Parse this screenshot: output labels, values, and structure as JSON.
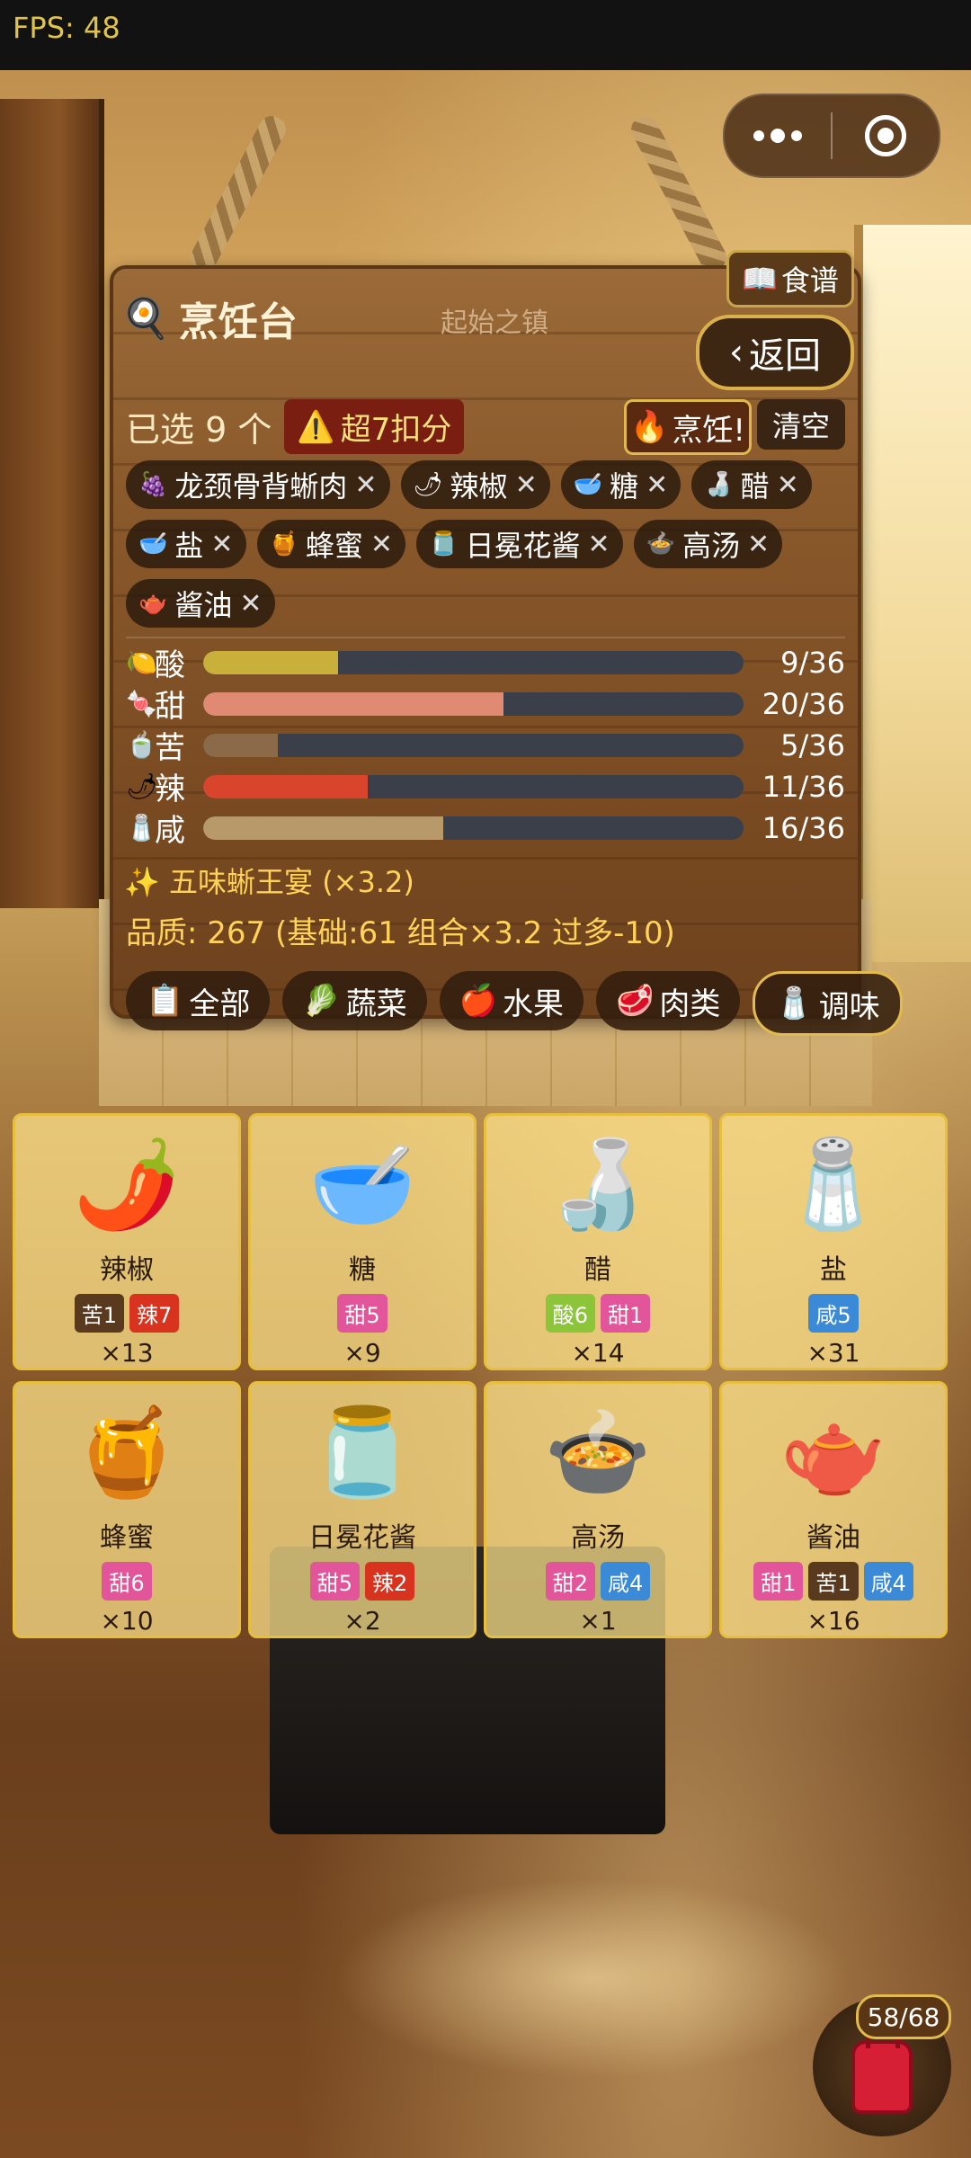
{
  "status": {
    "fps_text": "FPS: 48"
  },
  "header": {
    "title": "烹饪台",
    "location": "起始之镇",
    "recipe_label": "食谱",
    "back_label": "返回"
  },
  "selection": {
    "selected_text": "已选 9 个",
    "over_text": "超7扣分",
    "cook_label": "烹饪!",
    "clear_label": "清空",
    "chips": [
      {
        "icon": "🍇",
        "label": "龙颈骨背蜥肉"
      },
      {
        "icon": "🌶",
        "label": "辣椒"
      },
      {
        "icon": "🥣",
        "label": "糖"
      },
      {
        "icon": "🍶",
        "label": "醋"
      },
      {
        "icon": "🥣",
        "label": "盐"
      },
      {
        "icon": "🍯",
        "label": "蜂蜜"
      },
      {
        "icon": "🫙",
        "label": "日冕花酱"
      },
      {
        "icon": "🍲",
        "label": "高汤"
      },
      {
        "icon": "🫖",
        "label": "酱油"
      }
    ],
    "remove_glyph": "✕"
  },
  "tastes": [
    {
      "icon": "🍋",
      "name": "酸",
      "value": 9,
      "max": 36,
      "text": "9/36",
      "color": "#c9b03a"
    },
    {
      "icon": "🍬",
      "name": "甜",
      "value": 20,
      "max": 36,
      "text": "20/36",
      "color": "#e08a74"
    },
    {
      "icon": "🍵",
      "name": "苦",
      "value": 5,
      "max": 36,
      "text": "5/36",
      "color": "#8a6a48"
    },
    {
      "icon": "🌶",
      "name": "辣",
      "value": 11,
      "max": 36,
      "text": "11/36",
      "color": "#d8442c"
    },
    {
      "icon": "🧂",
      "name": "咸",
      "value": 16,
      "max": 36,
      "text": "16/36",
      "color": "#b89a6a"
    }
  ],
  "combo_text": "✨ 五味蜥王宴 (×3.2)",
  "quality_text": "品质: 267 (基础:61 组合×3.2 过多-10)",
  "tabs": [
    {
      "icon": "📋",
      "label": "全部",
      "active": false
    },
    {
      "icon": "🥬",
      "label": "蔬菜",
      "active": false
    },
    {
      "icon": "🍎",
      "label": "水果",
      "active": false
    },
    {
      "icon": "🥩",
      "label": "肉类",
      "active": false
    },
    {
      "icon": "🧂",
      "label": "调味",
      "active": true
    }
  ],
  "ingredients": [
    {
      "icon": "🌶️",
      "name": "辣椒",
      "count": "×13",
      "tags": [
        {
          "text": "苦1",
          "color": "#5a3a1e"
        },
        {
          "text": "辣7",
          "color": "#d8331f"
        }
      ]
    },
    {
      "icon": "🥣",
      "name": "糖",
      "count": "×9",
      "tags": [
        {
          "text": "甜5",
          "color": "#e2559a"
        }
      ]
    },
    {
      "icon": "🍶",
      "name": "醋",
      "count": "×14",
      "tags": [
        {
          "text": "酸6",
          "color": "#8cc43a"
        },
        {
          "text": "甜1",
          "color": "#e2559a"
        }
      ]
    },
    {
      "icon": "🧂",
      "name": "盐",
      "count": "×31",
      "tags": [
        {
          "text": "咸5",
          "color": "#3a8ad8"
        }
      ]
    },
    {
      "icon": "🍯",
      "name": "蜂蜜",
      "count": "×10",
      "tags": [
        {
          "text": "甜6",
          "color": "#e2559a"
        }
      ]
    },
    {
      "icon": "🫙",
      "name": "日冕花酱",
      "count": "×2",
      "tags": [
        {
          "text": "甜5",
          "color": "#e2559a"
        },
        {
          "text": "辣2",
          "color": "#d8331f"
        }
      ]
    },
    {
      "icon": "🍲",
      "name": "高汤",
      "count": "×1",
      "tags": [
        {
          "text": "甜2",
          "color": "#e2559a"
        },
        {
          "text": "咸4",
          "color": "#3a8ad8"
        }
      ]
    },
    {
      "icon": "🫖",
      "name": "酱油",
      "count": "×16",
      "tags": [
        {
          "text": "甜1",
          "color": "#e2559a"
        },
        {
          "text": "苦1",
          "color": "#5a3a1e"
        },
        {
          "text": "咸4",
          "color": "#3a8ad8"
        }
      ]
    }
  ],
  "bag": {
    "count_text": "58/68"
  }
}
